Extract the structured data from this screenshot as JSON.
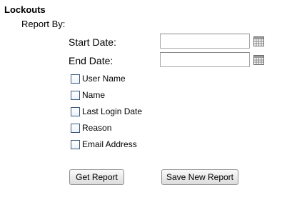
{
  "section": {
    "title": "Lockouts",
    "report_by_label": "Report By:"
  },
  "dates": {
    "start_label": "Start Date:",
    "start_value": "",
    "end_label": "End Date:",
    "end_value": "",
    "icon": "calendar-icon"
  },
  "options": [
    {
      "label": "User Name",
      "checked": false
    },
    {
      "label": "Name",
      "checked": false
    },
    {
      "label": "Last Login Date",
      "checked": false
    },
    {
      "label": "Reason",
      "checked": false
    },
    {
      "label": "Email Address",
      "checked": false
    }
  ],
  "buttons": {
    "get_report": "Get Report",
    "save_new_report": "Save New Report"
  }
}
